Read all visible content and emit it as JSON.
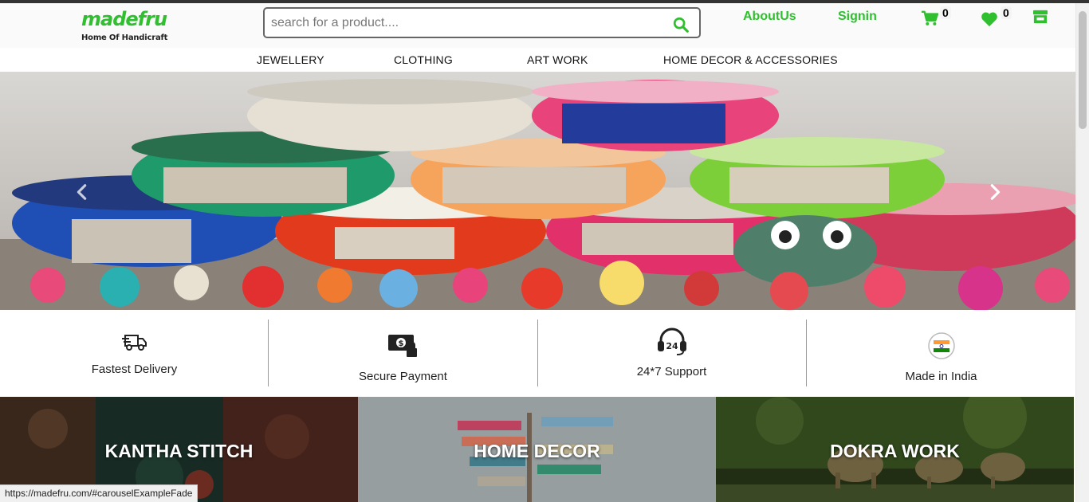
{
  "brand": {
    "name": "madefru",
    "tagline": "Home Of Handicraft",
    "accent_color": "#2fbf2f"
  },
  "search": {
    "placeholder": "search for a product....",
    "value": "",
    "icon": "search-icon"
  },
  "topnav": {
    "about": "AboutUs",
    "signin": "Signin",
    "cart_count": "0",
    "wishlist_count": "0",
    "icons": [
      "cart-icon",
      "heart-icon",
      "store-icon"
    ]
  },
  "categories": [
    "JEWELLERY",
    "CLOTHING",
    "ART WORK",
    "HOME DECOR & ACCESSORIES"
  ],
  "hero": {
    "prev_icon": "chevron-left-icon",
    "next_icon": "chevron-right-icon"
  },
  "features": [
    {
      "label": "Fastest Delivery",
      "icon": "delivery-truck-icon"
    },
    {
      "label": "Secure Payment",
      "icon": "secure-payment-icon"
    },
    {
      "label": "24*7 Support",
      "icon": "headset-support-icon"
    },
    {
      "label": "Made in India",
      "icon": "india-emblem-icon"
    }
  ],
  "tiles": [
    {
      "label": "KANTHA STITCH"
    },
    {
      "label": "HOME DECOR"
    },
    {
      "label": "DOKRA WORK"
    }
  ],
  "status_url": "https://madefru.com/#carouselExampleFade"
}
